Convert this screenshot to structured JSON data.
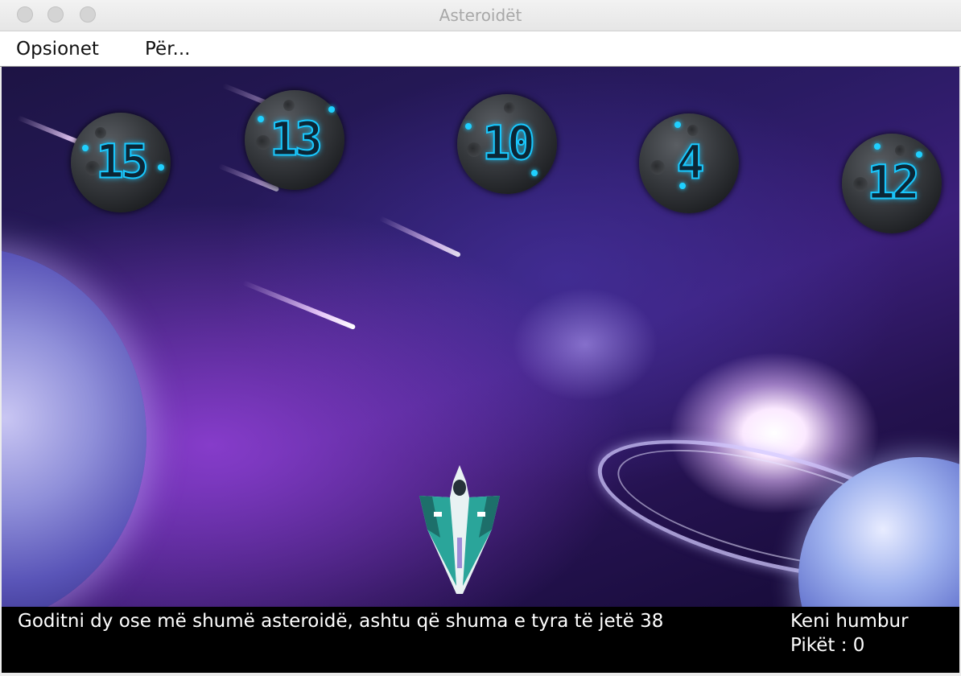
{
  "window": {
    "title": "Asteroidët"
  },
  "menu": {
    "options": "Opsionet",
    "about": "Për..."
  },
  "asteroids": [
    {
      "value": "15"
    },
    {
      "value": "13"
    },
    {
      "value": "10"
    },
    {
      "value": "4"
    },
    {
      "value": "12"
    }
  ],
  "status": {
    "instruction": "Goditni dy ose më shumë asteroidë, ashtu që shuma e tyra të jetë 38",
    "result": "Keni humbur",
    "score": "Pikët : 0"
  },
  "colors": {
    "asteroid_digits": "#18c8ff",
    "status_bg": "#000000",
    "menubar_bg": "#ffffff"
  }
}
